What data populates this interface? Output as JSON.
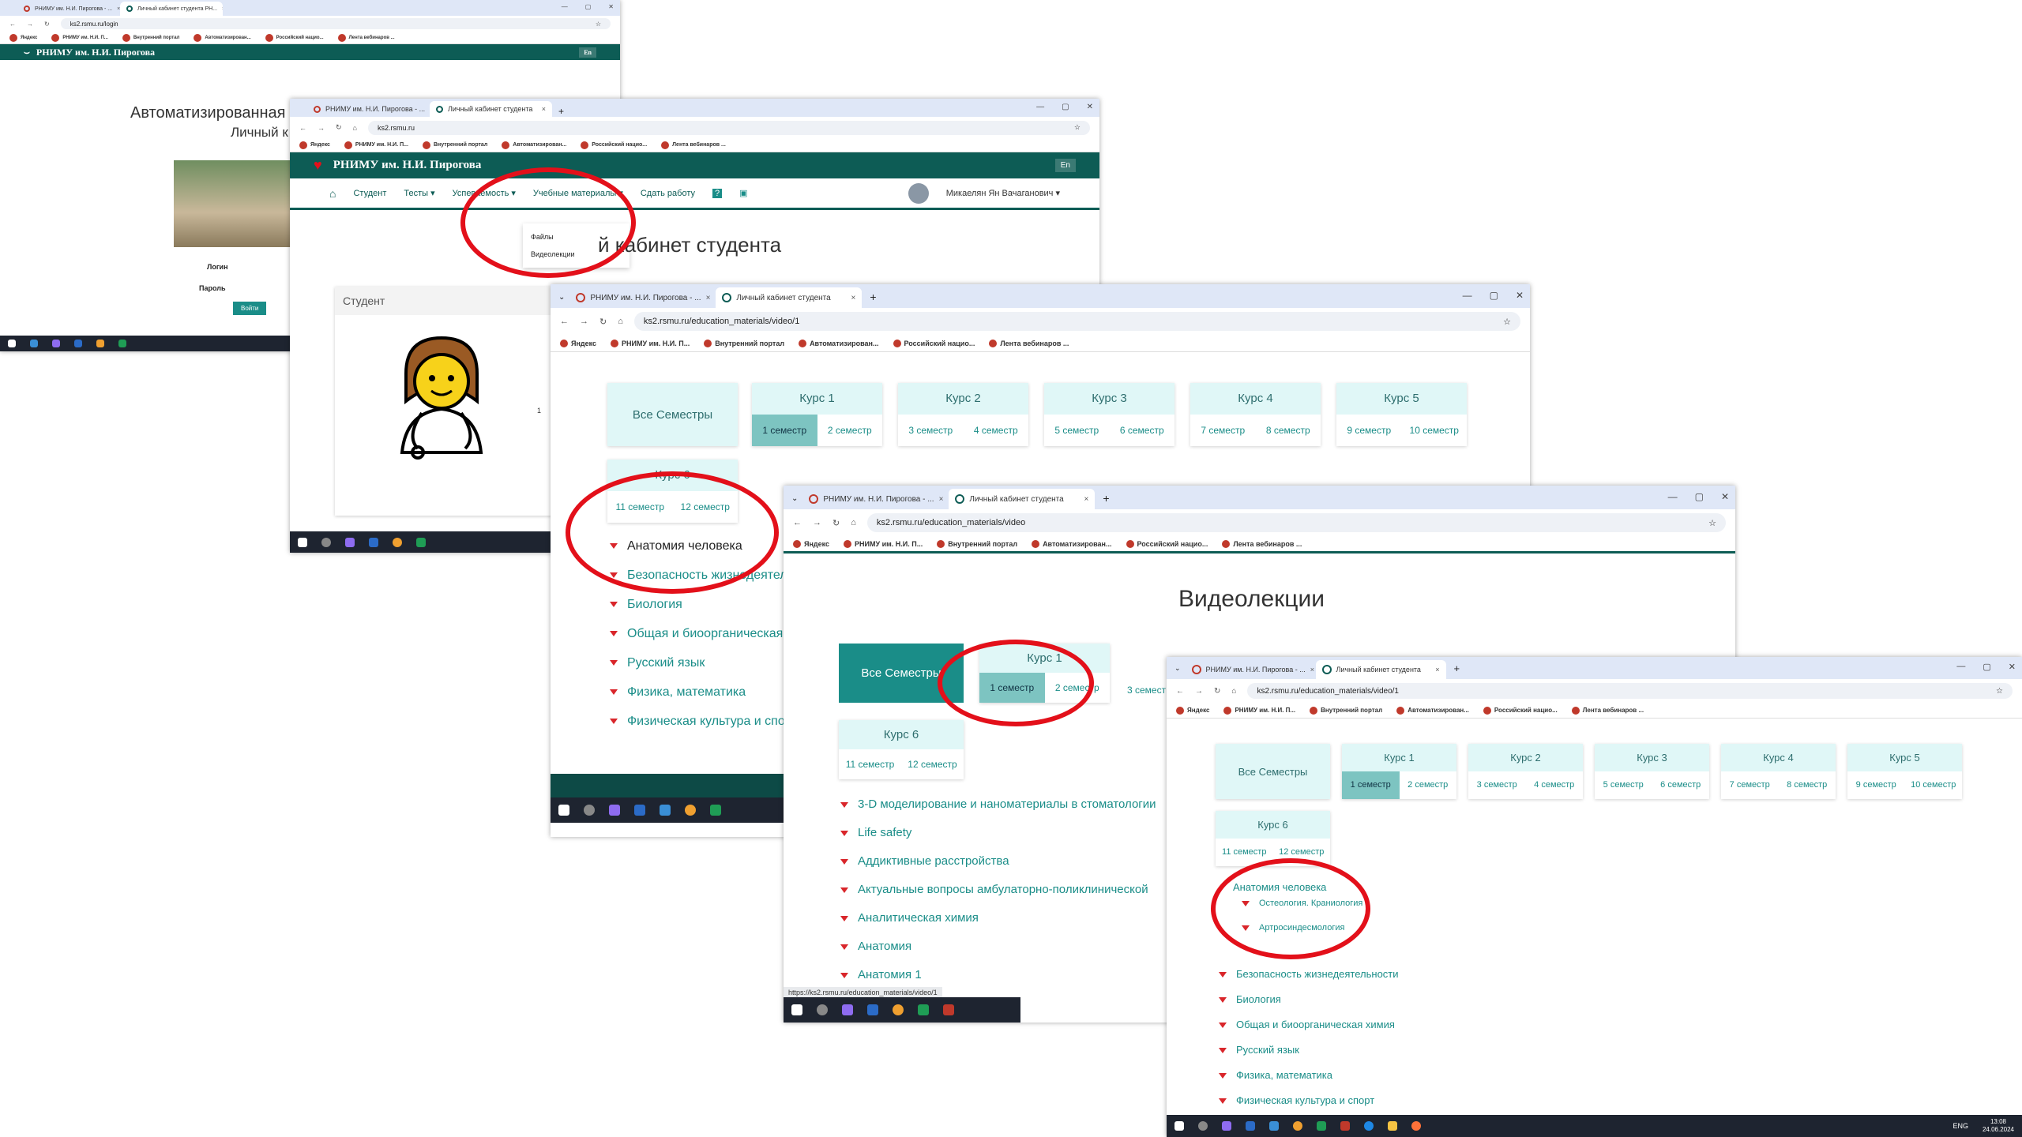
{
  "w1": {
    "tabs": [
      "РНИМУ им. Н.И. Пирогова - ...",
      "Личный кабинет студента РН..."
    ],
    "url": "ks2.rsmu.ru/login",
    "site": "РНИМУ им. Н.И. Пирогова",
    "lang": "En",
    "title1": "Автоматизированная",
    "title2": "Личный к",
    "login": "Логин",
    "password": "Пароль",
    "submit": "Войти",
    "bookmarks": [
      "Яндекс",
      "РНИМУ им. Н.И. П...",
      "Внутренний портал",
      "Автоматизирован...",
      "Российский нацио...",
      "Лента вебинаров ..."
    ]
  },
  "w2": {
    "tabs": [
      "РНИМУ им. Н.И. Пирогова - ...",
      "Личный кабинет студента"
    ],
    "url": "ks2.rsmu.ru",
    "site": "РНИМУ им. Н.И. Пирогова",
    "lang": "En",
    "nav": [
      "Студент",
      "Тесты",
      "Успеваемость",
      "Учебные материалы",
      "Сдать работу"
    ],
    "user": "Микаелян Ян Вачаганович",
    "dropdown": [
      "Файлы",
      "Видеолекции"
    ],
    "heading": "й кабинет студента",
    "card_title": "Студент",
    "card_num": "1",
    "bookmarks": [
      "Яндекс",
      "РНИМУ им. Н.И. П...",
      "Внутренний портал",
      "Автоматизирован...",
      "Российский нацио...",
      "Лента вебинаров ..."
    ]
  },
  "w3": {
    "tabs": [
      "РНИМУ им. Н.И. Пирогова - ...",
      "Личный кабинет студента"
    ],
    "url": "ks2.rsmu.ru/education_materials/video/1",
    "bookmarks": [
      "Яндекс",
      "РНИМУ им. Н.И. П...",
      "Внутренний портал",
      "Автоматизирован...",
      "Российский нацио...",
      "Лента вебинаров ..."
    ],
    "all": "Все Семестры",
    "courses": [
      {
        "t": "Курс 1",
        "s": [
          "1 семестр",
          "2 семестр"
        ]
      },
      {
        "t": "Курс 2",
        "s": [
          "3 семестр",
          "4 семестр"
        ]
      },
      {
        "t": "Курс 3",
        "s": [
          "5 семестр",
          "6 семестр"
        ]
      },
      {
        "t": "Курс 4",
        "s": [
          "7 семестр",
          "8 семестр"
        ]
      },
      {
        "t": "Курс 5",
        "s": [
          "9 семестр",
          "10 семестр"
        ]
      },
      {
        "t": "Курс 6",
        "s": [
          "11 семестр",
          "12 семестр"
        ]
      }
    ],
    "subjects": [
      "Анатомия человека",
      "Безопасность жизнедеятел",
      "Биология",
      "Общая и биоорганическая",
      "Русский язык",
      "Физика, математика",
      "Физическая культура и спо"
    ]
  },
  "w4": {
    "tabs": [
      "РНИМУ им. Н.И. Пирогова - ...",
      "Личный кабинет студента"
    ],
    "url": "ks2.rsmu.ru/education_materials/video",
    "bookmarks": [
      "Яндекс",
      "РНИМУ им. Н.И. П...",
      "Внутренний портал",
      "Автоматизирован...",
      "Российский нацио...",
      "Лента вебинаров ..."
    ],
    "heading": "Видеолекции",
    "all": "Все Семестры",
    "courses": [
      {
        "t": "Курс 1",
        "s": [
          "1 семестр",
          "2 семестр"
        ]
      },
      {
        "t": "Курс 6",
        "s": [
          "11 семестр",
          "12 семестр"
        ]
      }
    ],
    "partial": "3 семест",
    "subjects": [
      "3-D моделирование и наноматериалы в стоматологии",
      "Life safety",
      "Аддиктивные расстройства",
      "Актуальные вопросы амбулаторно-поликлинической",
      "Аналитическая химия",
      "Анатомия",
      "Анатомия 1"
    ],
    "status": "https://ks2.rsmu.ru/education_materials/video/1"
  },
  "w5": {
    "tabs": [
      "РНИМУ им. Н.И. Пирогова - ...",
      "Личный кабинет студента"
    ],
    "url": "ks2.rsmu.ru/education_materials/video/1",
    "bookmarks": [
      "Яндекс",
      "РНИМУ им. Н.И. П...",
      "Внутренний портал",
      "Автоматизирован...",
      "Российский нацио...",
      "Лента вебинаров ..."
    ],
    "all": "Все Семестры",
    "courses": [
      {
        "t": "Курс 1",
        "s": [
          "1 семестр",
          "2 семестр"
        ]
      },
      {
        "t": "Курс 2",
        "s": [
          "3 семестр",
          "4 семестр"
        ]
      },
      {
        "t": "Курс 3",
        "s": [
          "5 семестр",
          "6 семестр"
        ]
      },
      {
        "t": "Курс 4",
        "s": [
          "7 семестр",
          "8 семестр"
        ]
      },
      {
        "t": "Курс 5",
        "s": [
          "9 семестр",
          "10 семестр"
        ]
      },
      {
        "t": "Курс 6",
        "s": [
          "11 семестр",
          "12 семестр"
        ]
      }
    ],
    "main_subject": "Анатомия человека",
    "sub": [
      "Остеология. Краниология",
      "Артросиндесмология"
    ],
    "subjects": [
      "Безопасность жизнедеятельности",
      "Биология",
      "Общая и биоорганическая химия",
      "Русский язык",
      "Физика, математика",
      "Физическая культура и спорт"
    ],
    "tray": {
      "lang": "ENG",
      "time": "13:08",
      "date": "24.06.2024"
    }
  },
  "colors": {
    "teal": "#0d5c55",
    "accent": "#1a8d88",
    "red": "#e3101a"
  }
}
